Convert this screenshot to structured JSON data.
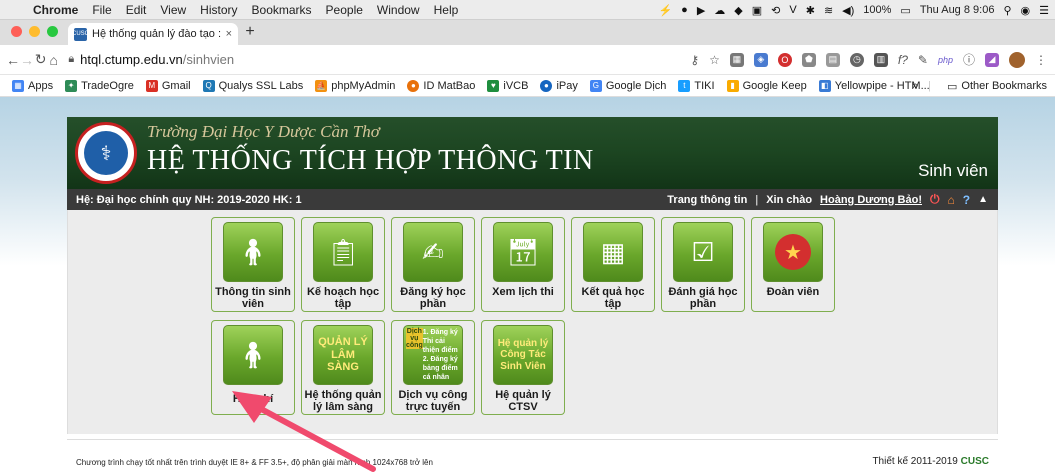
{
  "menubar": {
    "app": "Chrome",
    "items": [
      "File",
      "Edit",
      "View",
      "History",
      "Bookmarks",
      "People",
      "Window",
      "Help"
    ],
    "battery": "100%",
    "datetime": "Thu Aug 8 9:06"
  },
  "tab": {
    "title": "Hệ thống quản lý đào tạo :: Qu",
    "close": "×",
    "new": "+"
  },
  "address": {
    "host": "htql.ctump.edu.vn",
    "path": "/sinhvien"
  },
  "bookmarks": {
    "items": [
      {
        "label": "Apps",
        "color": "#4285f4"
      },
      {
        "label": "TradeOgre",
        "color": "#2e8b57"
      },
      {
        "label": "Gmail",
        "color": "#d93025"
      },
      {
        "label": "Qualys SSL Labs",
        "color": "#1f78b4"
      },
      {
        "label": "phpMyAdmin",
        "color": "#f29111"
      },
      {
        "label": "ID MatBao",
        "color": "#e8710a"
      },
      {
        "label": "iVCB",
        "color": "#1e8e3e"
      },
      {
        "label": "iPay",
        "color": "#1565c0"
      },
      {
        "label": "Google Dịch",
        "color": "#4285f4"
      },
      {
        "label": "TIKI",
        "color": "#189eff"
      },
      {
        "label": "Google Keep",
        "color": "#f9ab00"
      },
      {
        "label": "Yellowpipe - HTM...",
        "color": "#3a7bd5"
      }
    ],
    "more": "»",
    "other": "Other Bookmarks"
  },
  "site": {
    "university": "Trường Đại Học Y Dược Cần Thơ",
    "system": "HỆ THỐNG TÍCH HỢP THÔNG TIN",
    "role": "Sinh viên",
    "info": "Hệ: Đại học chính quy  NH: 2019-2020  HK: 1",
    "info_link": "Trang thông tin",
    "separator": "|",
    "greeting": "Xin chào",
    "user": "Hoàng Dương Bảo!"
  },
  "tiles": [
    {
      "label": "Thông tin sinh viên",
      "icon": "student-figure-icon"
    },
    {
      "label": "Kế hoạch học tập",
      "icon": "study-plan-icon"
    },
    {
      "label": "Đăng ký học phần",
      "icon": "course-register-icon"
    },
    {
      "label": "Xem lịch thi",
      "icon": "exam-calendar-icon"
    },
    {
      "label": "Kết quả học tập",
      "icon": "calculator-icon"
    },
    {
      "label": "Đánh giá học phần",
      "icon": "course-evaluation-icon"
    },
    {
      "label": "Đoàn viên",
      "icon": "youth-union-badge-icon"
    },
    {
      "label": "Học phí",
      "icon": "tuition-fee-icon"
    },
    {
      "label": "Hệ thống quản lý lâm sàng",
      "icon": "clinical-management-icon",
      "img_text": "QUẢN LÝ LÂM SÀNG"
    },
    {
      "label": "Dịch vụ công trực tuyến",
      "icon": "online-public-service-icon",
      "img_top": "Dịch vụ công",
      "img_lines": "1. Đăng ký Thi cải thiện điểm 2. Đăng ký bảng điểm cá nhân"
    },
    {
      "label": "Hệ quản lý CTSV",
      "icon": "student-affairs-icon",
      "img_text": "Hệ quản lý Công Tác Sinh Viên"
    }
  ],
  "footer": {
    "left": "Chương trình chạy tốt nhất trên trình duyệt IE 8+ & FF 3.5+, độ phân giải màn hình 1024x768 trở lên",
    "right_prefix": "Thiết kế 2011-2019",
    "right_brand": "CUSC"
  }
}
